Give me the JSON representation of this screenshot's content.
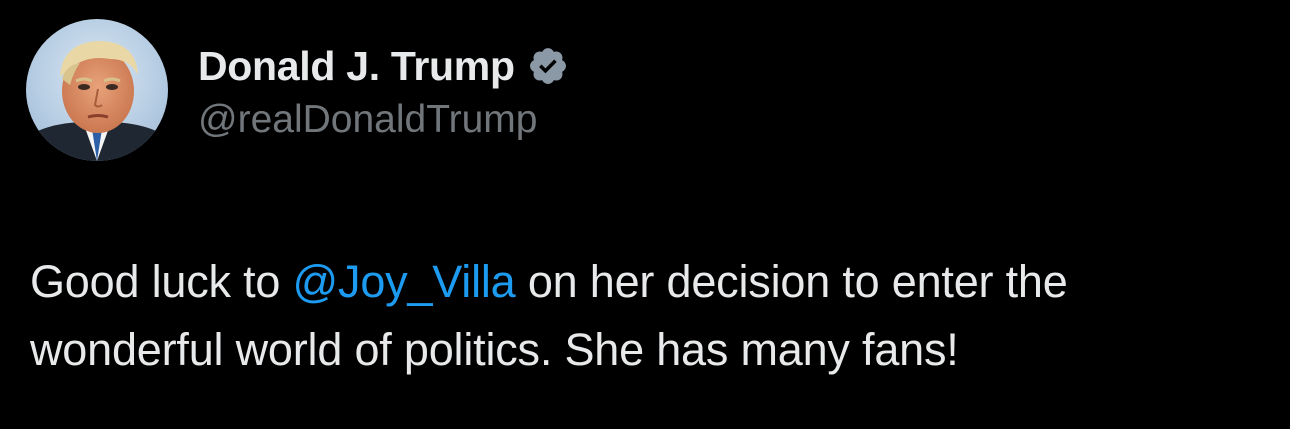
{
  "tweet": {
    "author": {
      "display_name": "Donald J. Trump",
      "handle": "@realDonaldTrump",
      "verified_icon": "verified-badge-icon",
      "avatar": "profile-photo"
    },
    "text": {
      "before_mention": "Good luck to ",
      "mention": "@Joy_Villa",
      "after_mention": " on her decision to enter the wonderful world of politics. She has many fans!"
    }
  },
  "colors": {
    "background": "#000000",
    "primary_text": "#e7e9ea",
    "secondary_text": "#71767b",
    "link": "#1d9bf0",
    "verified_badge": "#8b98a5"
  }
}
